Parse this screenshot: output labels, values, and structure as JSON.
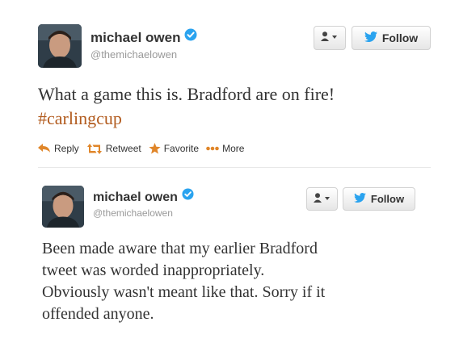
{
  "tweets": [
    {
      "user": {
        "name": "michael owen",
        "handle": "@themichaelowen"
      },
      "buttons": {
        "follow_label": "Follow"
      },
      "text_lines": [
        "What a game this is. Bradford are on fire!"
      ],
      "hashtag": "#carlingcup",
      "actions": {
        "reply": "Reply",
        "retweet": "Retweet",
        "favorite": "Favorite",
        "more": "More"
      }
    },
    {
      "user": {
        "name": "michael owen",
        "handle": "@themichaelowen"
      },
      "buttons": {
        "follow_label": "Follow"
      },
      "text_lines": [
        "Been made aware that my earlier Bradford",
        "tweet was worded inappropriately.",
        "Obviously wasn't meant like that. Sorry if it",
        "offended anyone."
      ]
    }
  ],
  "icons": {
    "verified": "verified-badge-icon",
    "user_menu": "user-dropdown-icon",
    "bird": "twitter-bird-icon",
    "reply": "reply-arrow-icon",
    "retweet": "retweet-icon",
    "favorite": "star-icon",
    "more": "more-dots-icon"
  },
  "colors": {
    "hashtag": "#b25b1e",
    "verified": "#2aa3ef",
    "twitter_blue": "#2aa3ef",
    "action_icons": "#e0862a"
  }
}
